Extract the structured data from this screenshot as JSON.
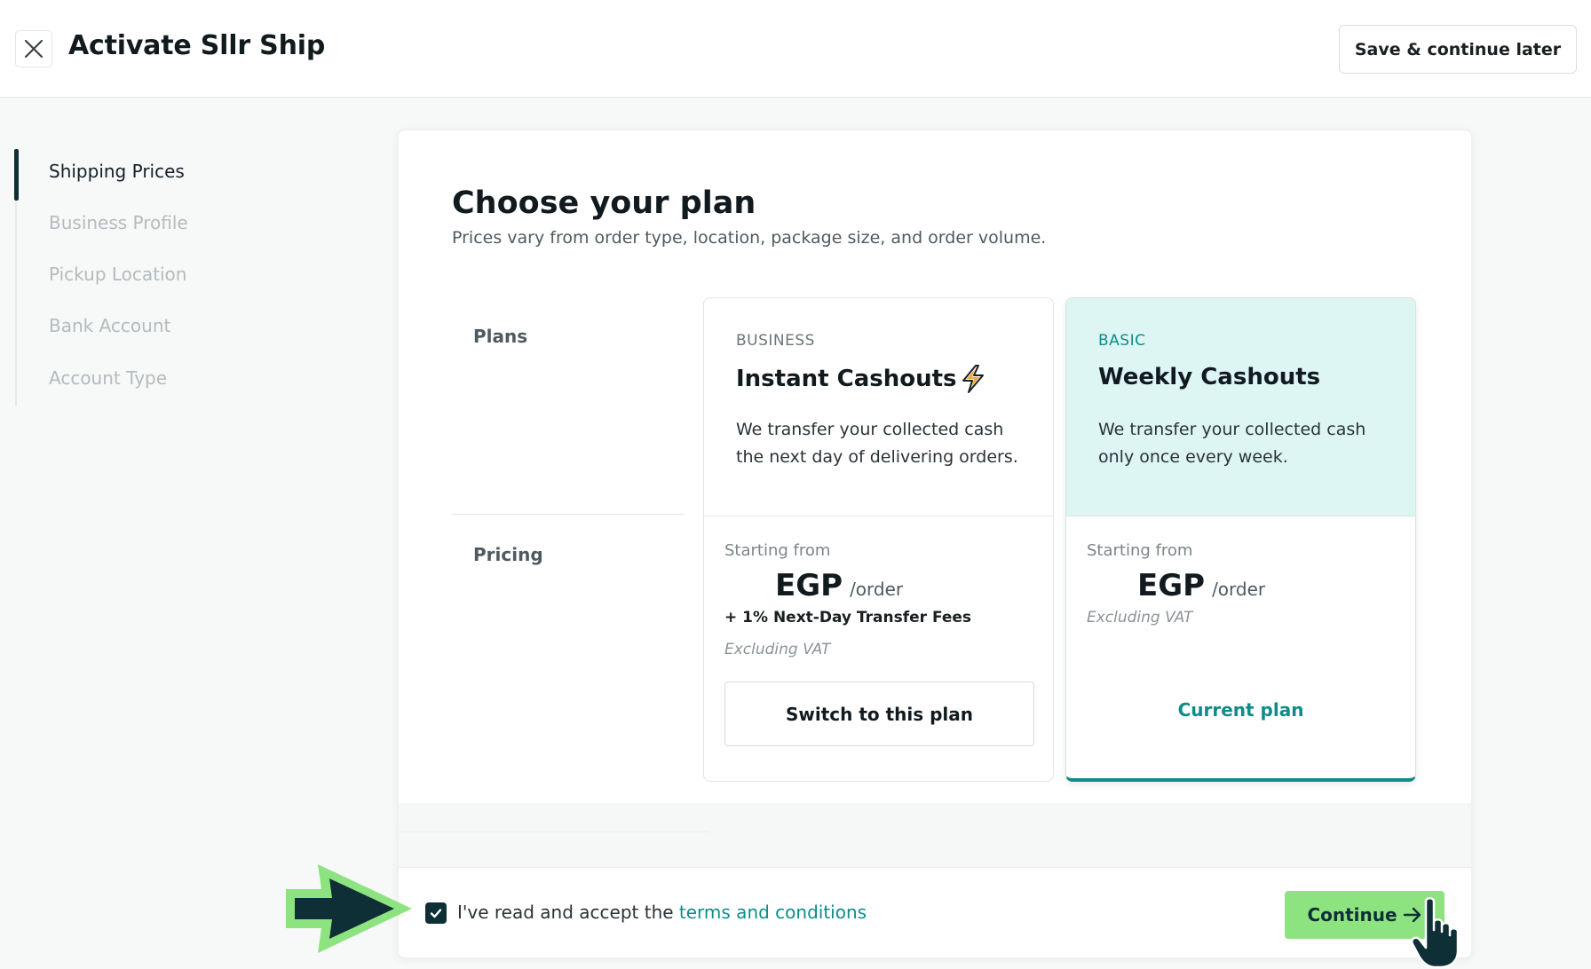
{
  "header": {
    "title": "Activate Sllr Ship",
    "save_label": "Save & continue later"
  },
  "steps": [
    {
      "label": "Shipping Prices",
      "active": true
    },
    {
      "label": "Business Profile",
      "active": false
    },
    {
      "label": "Pickup Location",
      "active": false
    },
    {
      "label": "Bank Account",
      "active": false
    },
    {
      "label": "Account Type",
      "active": false
    }
  ],
  "main": {
    "title": "Choose your plan",
    "subtitle": "Prices vary from order type, location, package size, and order volume.",
    "row_labels": {
      "plans": "Plans",
      "pricing": "Pricing"
    },
    "plans": [
      {
        "tier": "BUSINESS",
        "name": "Instant Cashouts",
        "icon": "lightning-bolt-icon",
        "description": "We transfer your collected cash the next day of delivering orders.",
        "starting_from": "Starting from",
        "currency": "EGP",
        "per_order": "/order",
        "fees": "+ 1% Next-Day Transfer Fees",
        "vat": "Excluding VAT",
        "action_label": "Switch to this plan"
      },
      {
        "tier": "BASIC",
        "name": "Weekly Cashouts",
        "description": "We transfer your collected cash only once every week.",
        "starting_from": "Starting from",
        "currency": "EGP",
        "per_order": "/order",
        "vat": "Excluding VAT",
        "status_label": "Current plan",
        "selected": true
      }
    ]
  },
  "footer": {
    "accept_text": "I've read and accept the ",
    "terms_link": "terms and conditions",
    "terms_checked": true,
    "continue_label": "Continue"
  },
  "colors": {
    "accent": "#0f8c8a",
    "primary_dark": "#0e2f36",
    "continue_bg": "#8ee381",
    "basic_plan_bg": "#ddf6f3"
  }
}
